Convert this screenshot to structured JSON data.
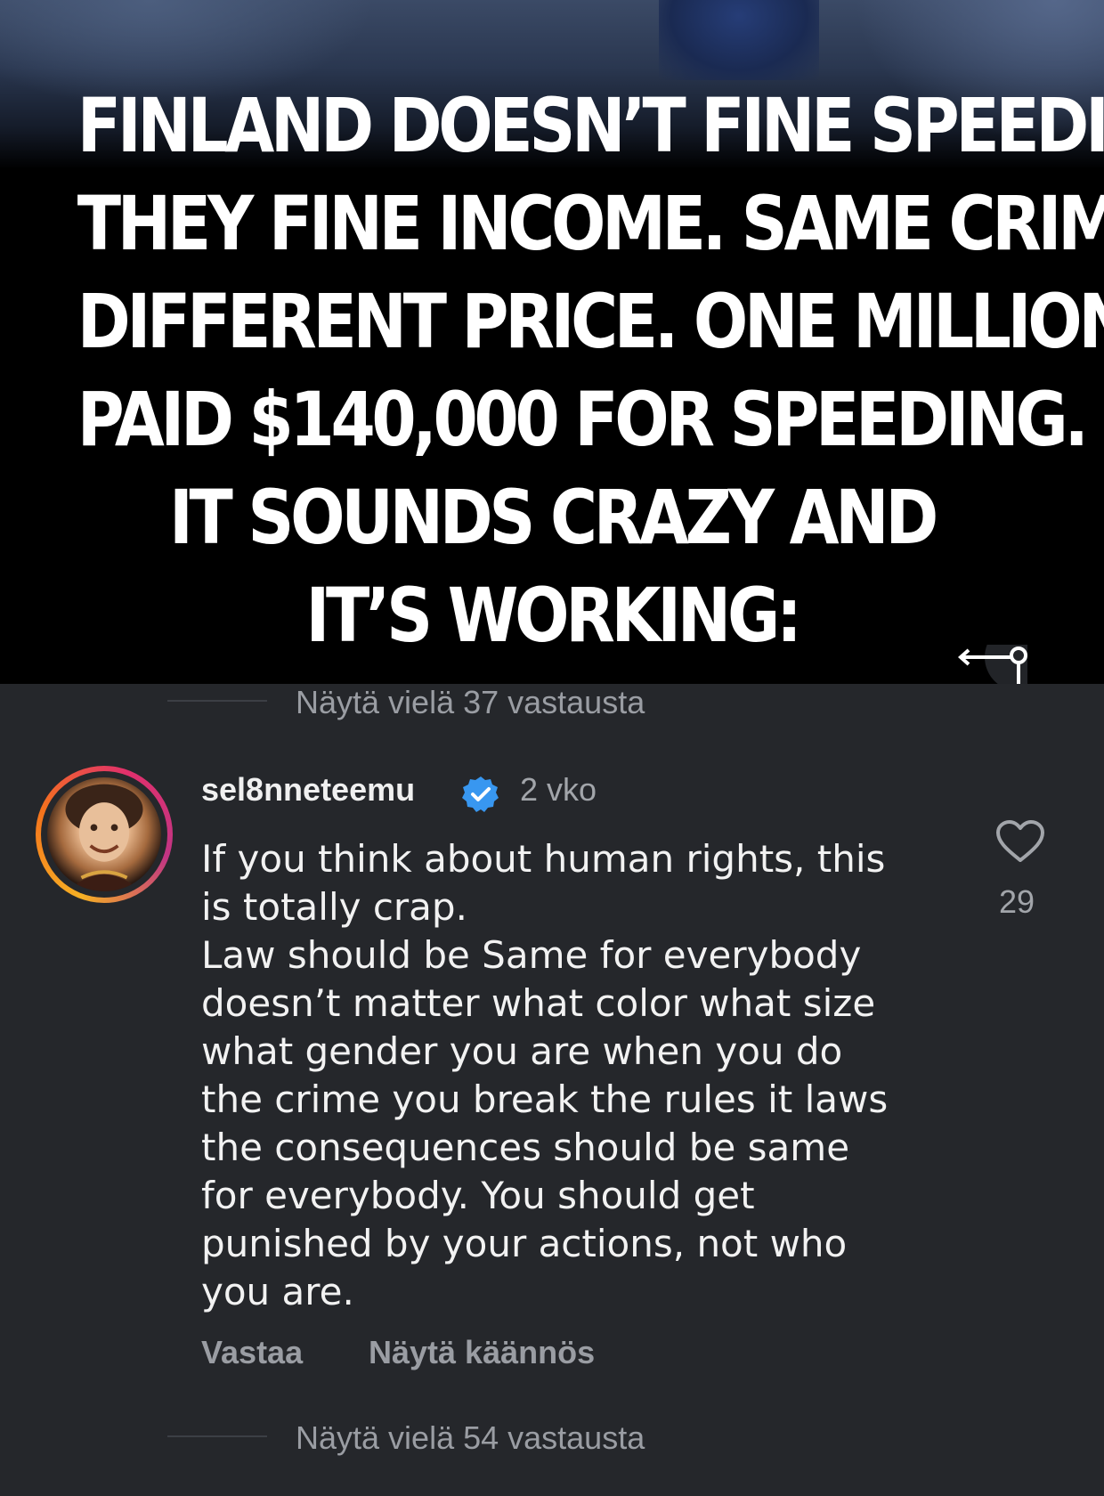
{
  "post": {
    "headline_lines": [
      "FINLAND DOESN’T FINE SPEEDING.",
      "THEY FINE INCOME. SAME CRIME.",
      "DIFFERENT PRICE. ONE MILLIONAIRE",
      "PAID $140,000 FOR SPEEDING.",
      "IT SOUNDS CRAZY AND",
      "IT’S WORKING:"
    ],
    "expand_icon": "arrow-pin-icon"
  },
  "replies_top": {
    "label": "Näytä vielä 37 vastausta"
  },
  "comment": {
    "username": "sel8nneteemu",
    "verified_icon": "verified-badge-icon",
    "timestamp": "2 vko",
    "text": "If you think about human rights, this\nis totally crap.\nLaw should be Same for everybody\ndoesn’t matter what color what size\nwhat gender you are when you do\nthe crime you break the rules it laws\nthe consequences should be same\nfor everybody. You should get\npunished by your actions, not who\nyou are.",
    "like_icon": "heart-icon",
    "like_count": "29",
    "actions": {
      "reply": "Vastaa",
      "translate": "Näytä käännös"
    }
  },
  "replies_bottom": {
    "label": "Näytä vielä 54 vastausta"
  },
  "colors": {
    "background": "#25272b",
    "text_primary": "#f2f2f2",
    "text_secondary": "#9a9da3",
    "verified_blue": "#3897f0"
  }
}
